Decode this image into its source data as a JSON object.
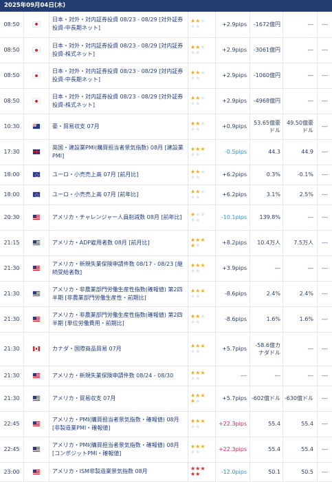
{
  "header": {
    "date": "2025年09月04日(木)"
  },
  "rows": [
    {
      "time": "08:50",
      "country": "jp",
      "flag_icon": "japan-flag-icon",
      "name": "日本・対外・対内証券投資 08/23 - 08/29 [対外証券投資-中長期ネット]",
      "stars": 2,
      "red": false,
      "pips": "+2.9pips",
      "pips_type": "pos",
      "previous": "-1672億円",
      "forecast": "---",
      "result": "---",
      "h": 37
    },
    {
      "time": "08:50",
      "country": "jp",
      "flag_icon": "japan-flag-icon",
      "name": "日本・対外・対内証券投資 08/23 - 08/29 [対内証券投資-株式ネット]",
      "stars": 2,
      "red": false,
      "pips": "+2.9pips",
      "pips_type": "pos",
      "previous": "-3061億円",
      "forecast": "---",
      "result": "---",
      "h": 37
    },
    {
      "time": "08:50",
      "country": "jp",
      "flag_icon": "japan-flag-icon",
      "name": "日本・対外・対内証券投資 08/23 - 08/29 [対内証券投資-中長期ネット]",
      "stars": 2,
      "red": false,
      "pips": "+2.9pips",
      "pips_type": "pos",
      "previous": "-1060億円",
      "forecast": "---",
      "result": "---",
      "h": 37
    },
    {
      "time": "08:50",
      "country": "jp",
      "flag_icon": "japan-flag-icon",
      "name": "日本・対外・対内証券投資 08/23 - 08/29 [対外証券投資-株式ネット]",
      "stars": 2,
      "red": false,
      "pips": "+2.9pips",
      "pips_type": "pos",
      "previous": "-4968億円",
      "forecast": "---",
      "result": "---",
      "h": 37
    },
    {
      "time": "10:30",
      "country": "au",
      "flag_icon": "australia-flag-icon",
      "name": "豪・貿易収支 07月",
      "stars": 2,
      "red": false,
      "pips": "+0.9pips",
      "pips_type": "pos",
      "previous": "53.65億豪ドル",
      "forecast": "49.50億豪ドル",
      "result": "---",
      "h": 37
    },
    {
      "time": "17:30",
      "country": "gb",
      "flag_icon": "uk-flag-icon",
      "name": "英国・建設業PMI(購買担当者景気指数) 08月 [建設業PMI]",
      "stars": 3,
      "red": false,
      "pips": "-0.5pips",
      "pips_type": "neg",
      "previous": "44.3",
      "forecast": "44.9",
      "result": "---",
      "h": 37
    },
    {
      "time": "18:00",
      "country": "eu",
      "flag_icon": "eu-flag-icon",
      "name": "ユーロ・小売売上高 07月 [前月比]",
      "stars": 2,
      "red": false,
      "pips": "+6.2pips",
      "pips_type": "pos",
      "previous": "0.3%",
      "forecast": "-0.1%",
      "result": "---",
      "h": 29
    },
    {
      "time": "18:00",
      "country": "eu",
      "flag_icon": "eu-flag-icon",
      "name": "ユーロ・小売売上高 07月 [前年比]",
      "stars": 2,
      "red": false,
      "pips": "+6.2pips",
      "pips_type": "pos",
      "previous": "3.1%",
      "forecast": "2.5%",
      "result": "---",
      "h": 29
    },
    {
      "time": "20:30",
      "country": "us",
      "flag_icon": "us-flag-icon",
      "name": "アメリカ・チャレンジャー人員削減数 08月 [前年比]",
      "stars": 1,
      "red": false,
      "pips": "-10.1pips",
      "pips_type": "neg",
      "previous": "139.8%",
      "forecast": "---",
      "result": "---",
      "h": 37
    },
    {
      "time": "21:15",
      "country": "us",
      "flag_icon": "us-flag-icon",
      "name": "アメリカ・ADP雇用者数 08月 [前月比]",
      "stars": 4,
      "red": false,
      "pips": "+8.2pips",
      "pips_type": "pos",
      "previous": "10.4万人",
      "forecast": "7.5万人",
      "result": "---",
      "h": 37
    },
    {
      "time": "21:30",
      "country": "us",
      "flag_icon": "us-flag-icon",
      "name": "アメリカ・新規失業保険申請件数 08/17 - 08/23 [継続受給者数]",
      "stars": 3,
      "red": false,
      "pips": "+3.9pips",
      "pips_type": "pos",
      "previous": "---",
      "forecast": "---",
      "result": "---",
      "h": 37
    },
    {
      "time": "21:30",
      "country": "us",
      "flag_icon": "us-flag-icon",
      "name": "アメリカ・非農業部門労働生産性指数(確報値) 第2四半期 [非農業部門労働生産性・前期比]",
      "stars": 3,
      "red": false,
      "pips": "-8.6pips",
      "pips_type": "pos",
      "previous": "2.4%",
      "forecast": "2.4%",
      "result": "---",
      "h": 37
    },
    {
      "time": "21:30",
      "country": "us",
      "flag_icon": "us-flag-icon",
      "name": "アメリカ・非農業部門労働生産性指数(確報値) 第2四半期 [単位労働費用・前期比]",
      "stars": 2,
      "red": false,
      "pips": "-8.6pips",
      "pips_type": "pos",
      "previous": "1.6%",
      "forecast": "1.6%",
      "result": "---",
      "h": 37
    },
    {
      "time": "21:30",
      "country": "ca",
      "flag_icon": "canada-flag-icon",
      "name": "カナダ・国際商品貿易 07月",
      "stars": 3,
      "red": false,
      "pips": "+5.7pips",
      "pips_type": "pos",
      "previous": "-58.6億カナダドル",
      "forecast": "---",
      "result": "---",
      "h": 49
    },
    {
      "time": "21:30",
      "country": "us",
      "flag_icon": "us-flag-icon",
      "name": "アメリカ・新規失業保険申請件数 08/24 - 08/30",
      "stars": 3,
      "red": false,
      "pips": "---",
      "pips_type": "pos",
      "previous": "---",
      "forecast": "---",
      "result": "---",
      "h": 29
    },
    {
      "time": "21:30",
      "country": "us",
      "flag_icon": "us-flag-icon",
      "name": "アメリカ・貿易収支 07月",
      "stars": 4,
      "red": false,
      "pips": "+5.7pips",
      "pips_type": "pos",
      "previous": "-602億ドル",
      "forecast": "-630億ドル",
      "result": "---",
      "h": 37
    },
    {
      "time": "22:45",
      "country": "us",
      "flag_icon": "us-flag-icon",
      "name": "アメリカ・PMI(購買担当者景気指数・確報値) 08月 [非製造業PMI・確報値]",
      "stars": 3,
      "red": false,
      "pips": "+22.3pips",
      "pips_type": "big",
      "previous": "55.4",
      "forecast": "55.4",
      "result": "---",
      "h": 37
    },
    {
      "time": "22:45",
      "country": "us",
      "flag_icon": "us-flag-icon",
      "name": "アメリカ・PMI(購買担当者景気指数・確報値) 08月 [コンポジットPMI・確報値]",
      "stars": 3,
      "red": false,
      "pips": "+22.3pips",
      "pips_type": "big",
      "previous": "55.4",
      "forecast": "55.4",
      "result": "---",
      "h": 37
    },
    {
      "time": "23:00",
      "country": "us",
      "flag_icon": "us-flag-icon",
      "name": "アメリカ・ISM非製造業景気指数 08月",
      "stars": 5,
      "red": true,
      "pips": "-12.0pips",
      "pips_type": "neg",
      "previous": "50.1",
      "forecast": "50.5",
      "result": "---",
      "h": 28
    }
  ]
}
